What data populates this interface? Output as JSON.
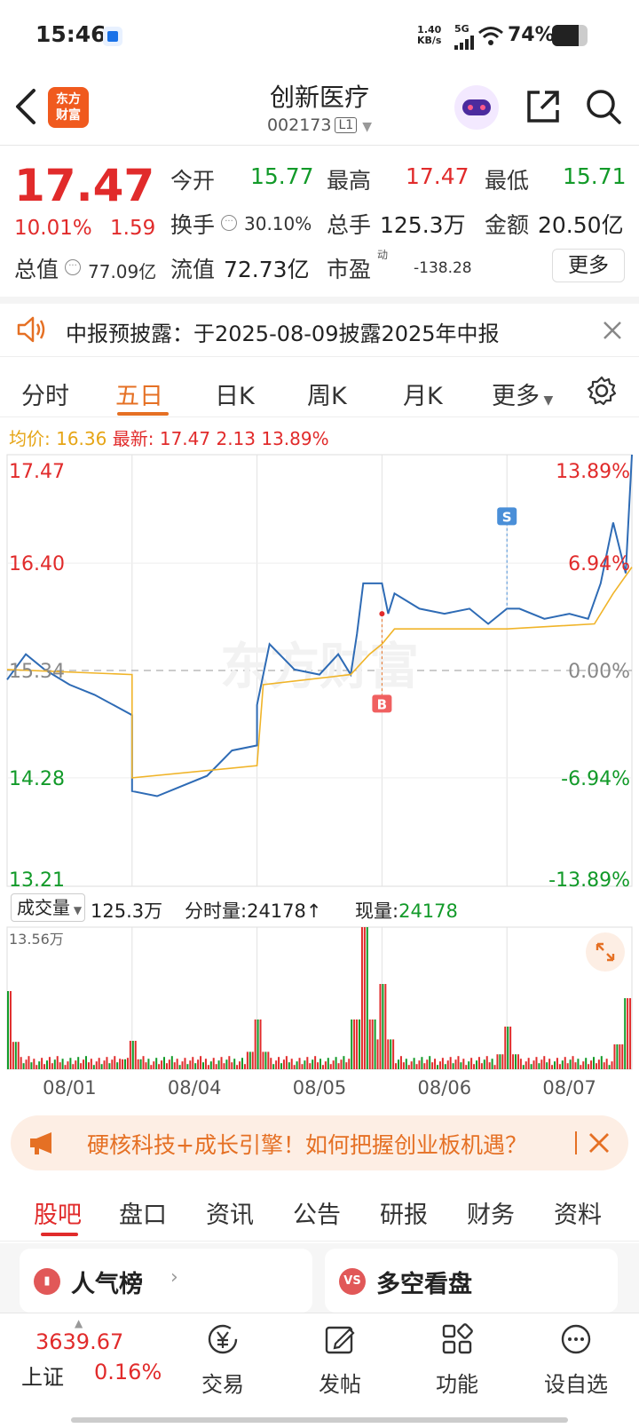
{
  "status": {
    "time": "15:46",
    "net_speed_top": "1.40",
    "net_speed_bottom": "KB/s",
    "network": "5G",
    "battery": "74%",
    "battery_level": 0.74
  },
  "header": {
    "logo_top": "东方",
    "logo_bottom": "财富",
    "title": "创新医疗",
    "code": "002173",
    "level": "L1"
  },
  "quote": {
    "price": "17.47",
    "change_pct": "10.01%",
    "change": "1.59",
    "open_label": "今开",
    "open": "15.77",
    "high_label": "最高",
    "high": "17.47",
    "low_label": "最低",
    "low": "15.71",
    "turnover_label": "换手",
    "turnover": "30.10%",
    "volume_label": "总手",
    "volume": "125.3万",
    "amount_label": "金额",
    "amount": "20.50亿",
    "mktcap_label": "总值",
    "mktcap": "77.09亿",
    "float_label": "流值",
    "float": "72.73亿",
    "pe_label": "市盈",
    "pe_sup": "动",
    "pe": "-138.28",
    "more": "更多"
  },
  "notice": {
    "text": "中报预披露：于2025-08-09披露2025年中报"
  },
  "tabs": [
    "分时",
    "五日",
    "日K",
    "周K",
    "月K",
    "更多"
  ],
  "avg": {
    "label": "均价:",
    "value": "16.36",
    "latest_label": "最新:",
    "latest": "17.47",
    "change": "2.13",
    "pct": "13.89%"
  },
  "chart_data": {
    "type": "line",
    "y_left": [
      "17.47",
      "16.40",
      "15.34",
      "14.28",
      "13.21"
    ],
    "y_right": [
      "13.89%",
      "6.94%",
      "0.00%",
      "-6.94%",
      "-13.89%"
    ],
    "ylim": [
      13.21,
      17.47
    ],
    "reference": 15.34,
    "days": [
      "08/01",
      "08/04",
      "08/05",
      "08/06",
      "08/07"
    ],
    "markers": {
      "buy": "B",
      "sell": "S"
    },
    "watermark": "东方财富",
    "volume_selector": "成交量",
    "volume_total": "125.3万",
    "tick_label": "分时量:",
    "tick_value": "24178",
    "now_label": "现量:",
    "now_value": "24178",
    "volume_max": "13.56万"
  },
  "banner": {
    "text": "硬核科技+成长引擎！如何把握创业板机遇？"
  },
  "bottom_tabs": [
    "股吧",
    "盘口",
    "资讯",
    "公告",
    "研报",
    "财务",
    "资料"
  ],
  "cards": [
    {
      "label": "人气榜",
      "icon": "rank-icon"
    },
    {
      "label": "多空看盘",
      "icon": "vs-icon"
    }
  ],
  "index": {
    "value": "3639.67",
    "name": "上证",
    "pct": "0.16%"
  },
  "nav": [
    "交易",
    "发帖",
    "功能",
    "设自选"
  ],
  "colors": {
    "red": "#e12b2b",
    "green": "#129a29",
    "orange": "#e57024",
    "line": "#2e6bb5",
    "avg": "#f0b429"
  }
}
